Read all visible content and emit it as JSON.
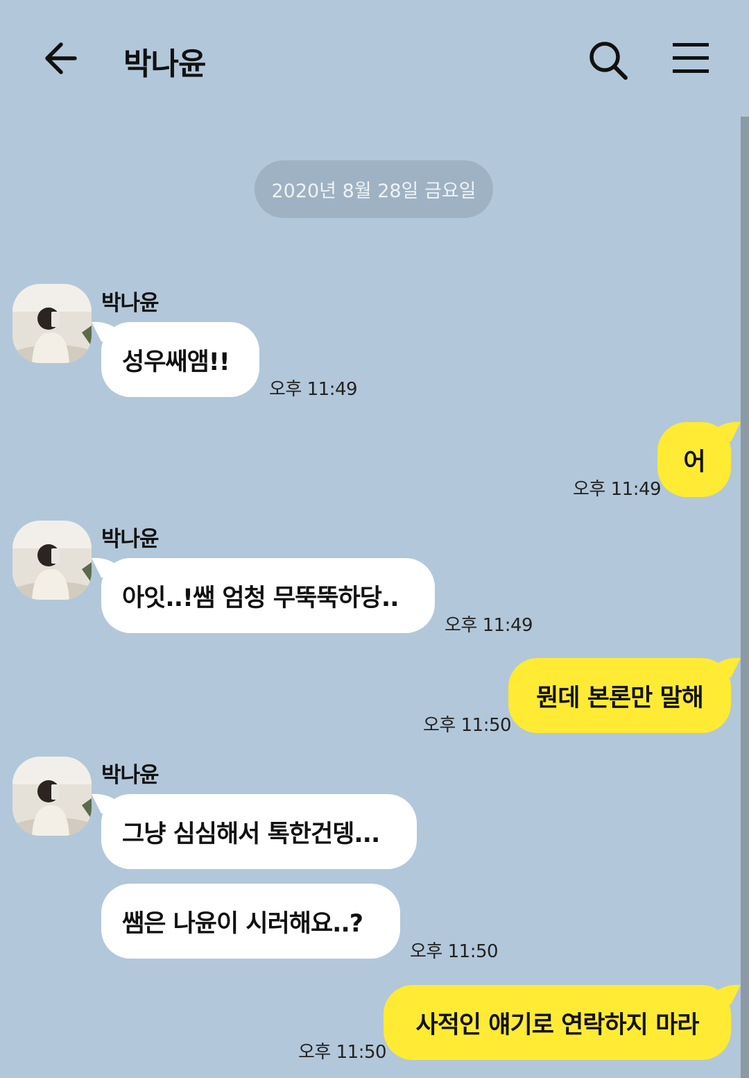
{
  "header": {
    "title": "박나윤",
    "back_icon": "arrow-left-icon",
    "search_icon": "search-icon",
    "menu_icon": "hamburger-menu-icon"
  },
  "date_divider": "2020년 8월 28일 금요일",
  "colors": {
    "background": "#b2c7da",
    "incoming_bubble": "#ffffff",
    "outgoing_bubble": "#ffeb33",
    "date_pill": "#9fb2c3"
  },
  "messages": [
    {
      "sender": "박나윤",
      "text": "성우쌔앰!!",
      "time": "오후 11:49",
      "direction": "in"
    },
    {
      "text": "어",
      "time": "오후 11:49",
      "direction": "out"
    },
    {
      "sender": "박나윤",
      "text": "아잇..!쌤 엄청 무뚝뚝하당..",
      "time": "오후 11:49",
      "direction": "in"
    },
    {
      "text": "뭔데 본론만 말해",
      "time": "오후 11:50",
      "direction": "out"
    },
    {
      "sender": "박나윤",
      "text": "그냥 심심해서 톡한건뎅...",
      "direction": "in"
    },
    {
      "text": "쌤은 나윤이 시러해요..?",
      "time": "오후 11:50",
      "direction": "in"
    },
    {
      "text": "사적인 얘기로 연락하지 마라",
      "time": "오후 11:50",
      "direction": "out"
    }
  ]
}
